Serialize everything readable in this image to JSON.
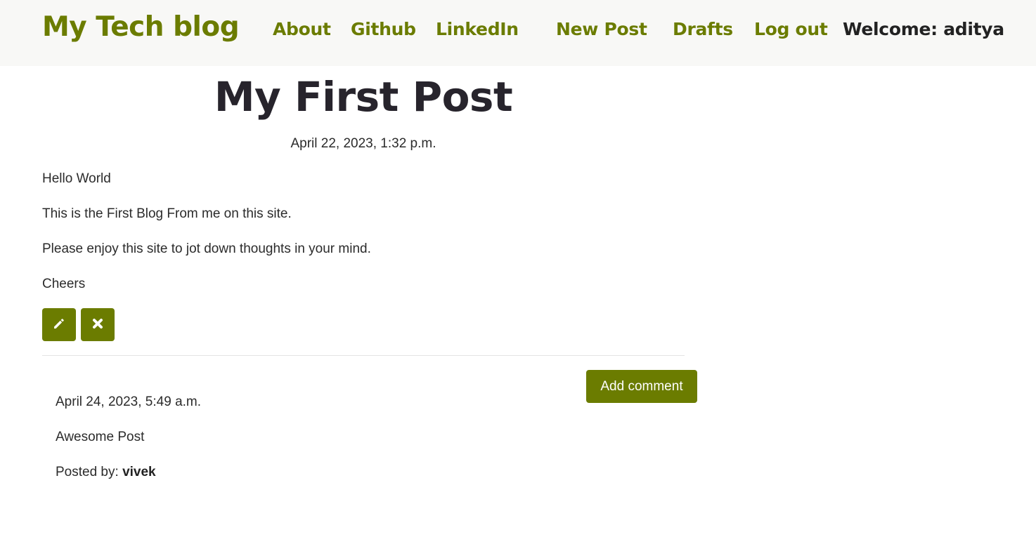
{
  "nav": {
    "brand": "My Tech blog",
    "links": [
      "About",
      "Github",
      "LinkedIn",
      "New Post",
      "Drafts",
      "Log out"
    ],
    "welcome": "Welcome: aditya",
    "accent_color": "#6b7c00"
  },
  "post": {
    "title": "My First Post",
    "date": "April 22, 2023, 1:32 p.m.",
    "paragraphs": [
      "Hello World",
      "This is the First Blog From me on this site.",
      "Please enjoy this site to jot down thoughts in your mind.",
      "Cheers"
    ],
    "actions": {
      "edit_icon": "pencil-icon",
      "delete_icon": "close-icon"
    }
  },
  "comments": {
    "add_label": "Add comment",
    "items": [
      {
        "date": "April 24, 2023, 5:49 a.m.",
        "text": "Awesome Post",
        "posted_by_label": "Posted by:",
        "author": "vivek"
      }
    ]
  }
}
